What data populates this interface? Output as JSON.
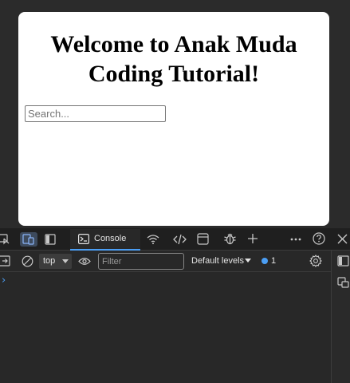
{
  "page": {
    "heading": "Welcome to Anak Muda Coding Tutorial!",
    "search": {
      "placeholder": "Search...",
      "value": ""
    }
  },
  "devtools": {
    "tabs": [
      {
        "label": "Console",
        "active": true
      }
    ],
    "toolbar": {
      "context": "top",
      "filter_placeholder": "Filter",
      "levels_label": "Default levels",
      "issues_count": "1"
    },
    "console": {
      "prompt": "›"
    },
    "colors": {
      "accent": "#4b9ef4",
      "panel_bg": "#282828",
      "topbar_bg": "#1f1f1f"
    }
  }
}
